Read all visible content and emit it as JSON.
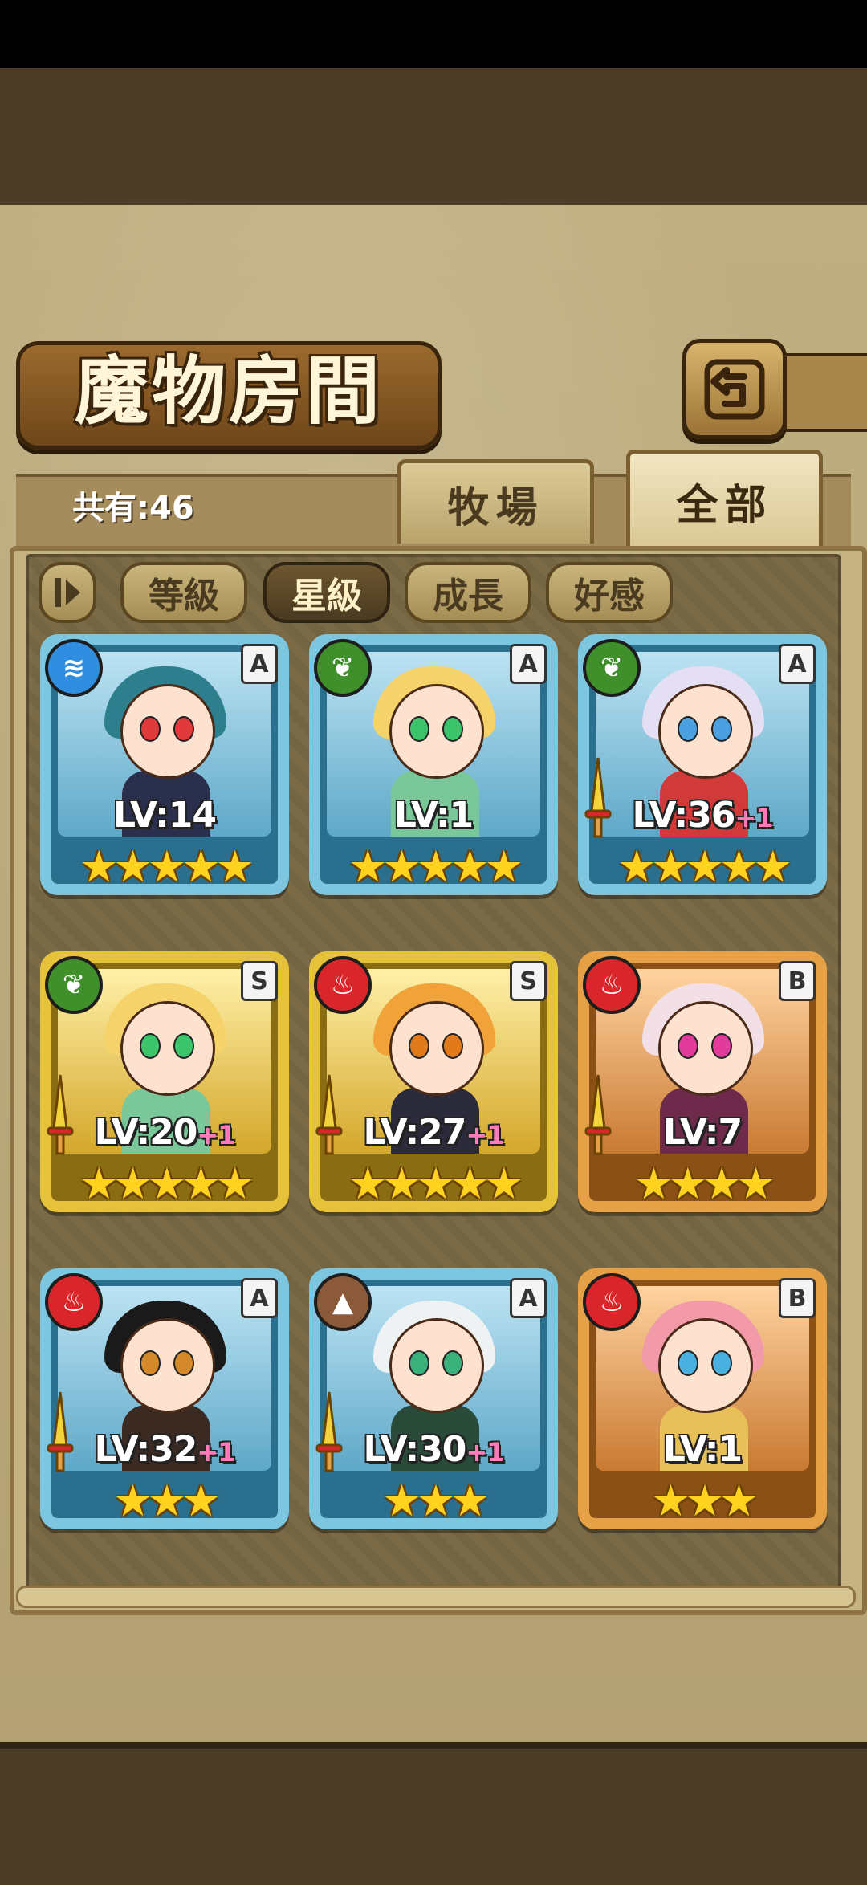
{
  "header": {
    "title": "魔物房間",
    "back_icon": "back-arrow-icon"
  },
  "tabs": {
    "count_label": "共有:46",
    "items": [
      {
        "label": "牧場",
        "active": false
      },
      {
        "label": "全部",
        "active": true
      }
    ]
  },
  "sort": {
    "toggle_icon": "sort-toggle-icon",
    "items": [
      {
        "label": "等級",
        "active": false
      },
      {
        "label": "星級",
        "active": true
      },
      {
        "label": "成長",
        "active": false
      },
      {
        "label": "好感",
        "active": false
      }
    ]
  },
  "cards": [
    {
      "frame": "blue",
      "element": "water",
      "rank": "A",
      "lv": "LV:14",
      "plus": "",
      "stars": "★★★★★",
      "sword": false,
      "hair": "#2e7f8d",
      "outfit": "#2a2f4e",
      "eyes": "#e03a3a"
    },
    {
      "frame": "blue",
      "element": "leaf",
      "rank": "A",
      "lv": "LV:1",
      "plus": "",
      "stars": "★★★★★",
      "sword": false,
      "hair": "#f5d36a",
      "outfit": "#7ac79a",
      "eyes": "#3cc46a"
    },
    {
      "frame": "blue",
      "element": "leaf",
      "rank": "A",
      "lv": "LV:36",
      "plus": "+1",
      "stars": "★★★★★",
      "sword": true,
      "hair": "#e4dff2",
      "outfit": "#d23a3a",
      "eyes": "#4aa0e0"
    },
    {
      "frame": "gold",
      "element": "leaf",
      "rank": "S",
      "lv": "LV:20",
      "plus": "+1",
      "stars": "★★★★★",
      "sword": true,
      "hair": "#f5d36a",
      "outfit": "#7ac79a",
      "eyes": "#3cc46a"
    },
    {
      "frame": "gold",
      "element": "fire",
      "rank": "S",
      "lv": "LV:27",
      "plus": "+1",
      "stars": "★★★★★",
      "sword": true,
      "hair": "#f1a33a",
      "outfit": "#2a2a3a",
      "eyes": "#e07a1a"
    },
    {
      "frame": "bronze",
      "element": "fire",
      "rank": "B",
      "lv": "LV:7",
      "plus": "",
      "stars": "★★★★",
      "sword": true,
      "hair": "#f3dfe6",
      "outfit": "#6e2a4a",
      "eyes": "#e03a9a"
    },
    {
      "frame": "blue",
      "element": "fire",
      "rank": "A",
      "lv": "LV:32",
      "plus": "+1",
      "stars": "★★★",
      "sword": true,
      "hair": "#1a1a1a",
      "outfit": "#3a2a22",
      "eyes": "#d48a2a"
    },
    {
      "frame": "blue",
      "element": "earth",
      "rank": "A",
      "lv": "LV:30",
      "plus": "+1",
      "stars": "★★★",
      "sword": true,
      "hair": "#eef2f2",
      "outfit": "#2a4a3a",
      "eyes": "#3ab07a"
    },
    {
      "frame": "bronze",
      "element": "fire",
      "rank": "B",
      "lv": "LV:1",
      "plus": "",
      "stars": "★★★",
      "sword": false,
      "hair": "#f39aaa",
      "outfit": "#e8c05a",
      "eyes": "#4ab0e0"
    }
  ],
  "colors": {
    "water": "#2f8ee0",
    "leaf": "#3f8f2a",
    "fire": "#d8262a",
    "earth": "#8a5a3a",
    "star": "#ffd21f",
    "plus": "#ff7ab8"
  }
}
